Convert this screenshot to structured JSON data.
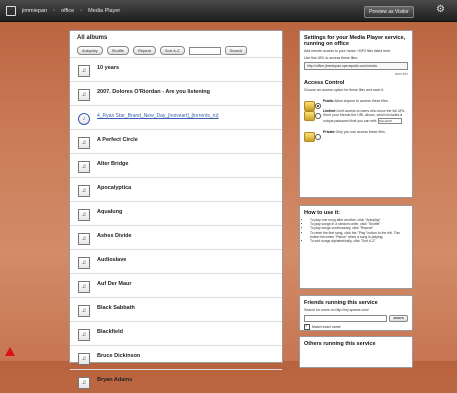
{
  "topbar": {
    "breadcrumbs": [
      "jimmiepan",
      "office",
      "Media Player"
    ],
    "preview_label": "Preview as Visitor"
  },
  "albums": {
    "heading": "All albums",
    "buttons": [
      "Autoplay",
      "Shuffle",
      "Repeat",
      "Sort A-Z"
    ],
    "search_label": "Search",
    "items": [
      {
        "label": "10 years",
        "type": "album"
      },
      {
        "label": "2007. Dolores O'Riordan - Are you listening",
        "type": "album"
      },
      {
        "label": "4_Ryan Star_Brand_New_Day_[noiveart]_[torrents_ru]",
        "type": "file"
      },
      {
        "label": "A Perfect Circle",
        "type": "album"
      },
      {
        "label": "Alter Bridge",
        "type": "album"
      },
      {
        "label": "Apocalyptica",
        "type": "album"
      },
      {
        "label": "Aqualung",
        "type": "album"
      },
      {
        "label": "Ashes Divide",
        "type": "album"
      },
      {
        "label": "Audioslave",
        "type": "album"
      },
      {
        "label": "Auf Der Maur",
        "type": "album"
      },
      {
        "label": "Black Sabbath",
        "type": "album"
      },
      {
        "label": "Blackfield",
        "type": "album"
      },
      {
        "label": "Bruce Dickinson",
        "type": "album"
      },
      {
        "label": "Bryan Adams",
        "type": "album"
      }
    ]
  },
  "settings": {
    "title": "Settings for your Media Player service, running on office",
    "intro": "Add remote access to your music / MP3 files listed here.",
    "url_hint": "Use this URL to access these files:",
    "url": "http://office.jimmiepan.spenapolis.com/media",
    "url_note": "more info",
    "access_title": "Access Control",
    "access_text": "Choose an access option for these files and save it.",
    "options": [
      {
        "name": "Public",
        "text": "Allow anyone to access these files.",
        "selected": true
      },
      {
        "name": "Limited",
        "text": "Limit access to users who know the full URL. Send your friends the URL above, which includes a unique password that you can edit:",
        "selected": false
      },
      {
        "name": "Private",
        "text": "Only you can access these files.",
        "selected": false
      }
    ],
    "password_value": "5ebo4iA5"
  },
  "howto": {
    "title": "How to use it:",
    "tips": [
      "To play one song after another, click \"Autoplay\"",
      "To play songs in a random order, click \"Shuffle\"",
      "To play songs continuously, click \"Repeat\"",
      "To rebel the first song, click the \"Play\" button to the left. This button becomes \"Pause\" when a song is playing.",
      "To sort songs alphabetically, click \"Sort A-Z\""
    ]
  },
  "friends": {
    "title": "Friends running this service",
    "search_hint": "Search for users on http://my.spanar.com/",
    "search_label": "search",
    "checkbox_label": "Match exact name"
  },
  "others": {
    "title": "Others running this service"
  }
}
